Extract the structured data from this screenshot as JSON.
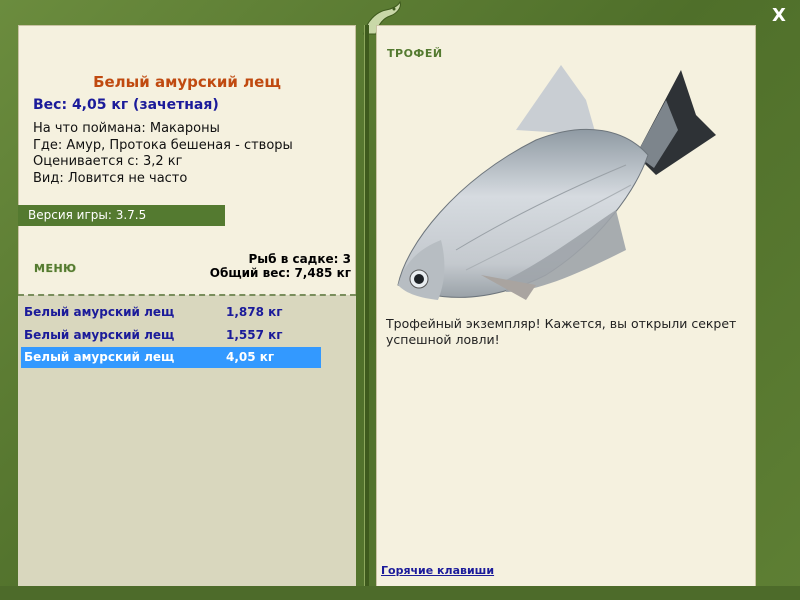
{
  "window": {
    "close_label": "X"
  },
  "fish": {
    "name": "Белый амурский лещ",
    "weight_line": "Вес: 4,05 кг (зачетная)",
    "details": [
      "На что поймана: Макароны",
      "Где: Амур, Протока бешеная - створы",
      "Оценивается с: 3,2 кг",
      "Вид: Ловится не часто"
    ]
  },
  "version": "Версия игры: 3.7.5",
  "menu_label": "МЕНЮ",
  "cage": {
    "count_line": "Рыб в садке: 3",
    "total_line": "Общий вес: 7,485 кг"
  },
  "catch_list": [
    {
      "name": "Белый амурский лещ",
      "weight": "1,878 кг",
      "selected": false
    },
    {
      "name": "Белый амурский лещ",
      "weight": "1,557 кг",
      "selected": false
    },
    {
      "name": "Белый амурский лещ",
      "weight": "4,05 кг",
      "selected": true
    }
  ],
  "trophy": {
    "label": "ТРОФЕЙ",
    "text": "Трофейный экземпляр! Кажется, вы открыли секрет успешной ловли!"
  },
  "hotkeys_link": "Горячие клавиши",
  "colors": {
    "frame": "#5a7a33",
    "panel": "#f5f1df",
    "selected": "#3399ff",
    "title": "#c04a10",
    "accent_text": "#1b1b9a"
  }
}
